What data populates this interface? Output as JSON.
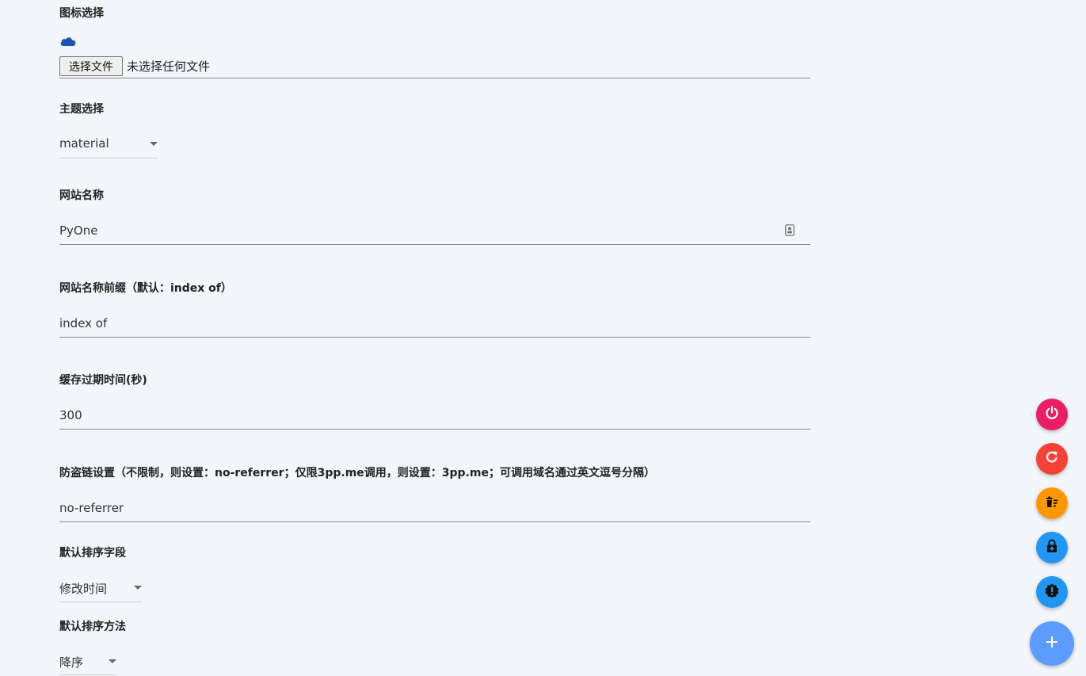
{
  "icon_section": {
    "label": "图标选择",
    "icon": "cloud-icon",
    "icon_color": "#1a56b8",
    "file_button_label": "选择文件",
    "file_status": "未选择任何文件"
  },
  "theme": {
    "label": "主题选择",
    "value": "material"
  },
  "site_name": {
    "label": "网站名称",
    "value": "PyOne",
    "trailing_icon": "contact-card-icon"
  },
  "title_prefix": {
    "label": "网站名称前缀（默认：index of）",
    "value": "index of"
  },
  "cache_expire": {
    "label": "缓存过期时间(秒)",
    "value": "300"
  },
  "hotlink": {
    "label": "防盗链设置（不限制，则设置：no-referrer；仅限3pp.me调用，则设置：3pp.me；可调用域名通过英文逗号分隔）",
    "value": "no-referrer"
  },
  "sort_field": {
    "label": "默认排序字段",
    "value": "修改时间"
  },
  "sort_order": {
    "label": "默认排序方法",
    "value": "降序"
  },
  "fabs": [
    {
      "name": "power-icon",
      "color": "#e91e63"
    },
    {
      "name": "refresh-icon",
      "color": "#f44336"
    },
    {
      "name": "clear-cache-icon",
      "color": "#ff9800"
    },
    {
      "name": "lock-add-icon",
      "color": "#2196f3"
    },
    {
      "name": "alert-badge-icon",
      "color": "#2196f3"
    },
    {
      "name": "plus-icon",
      "color": "#5c9bff"
    }
  ]
}
